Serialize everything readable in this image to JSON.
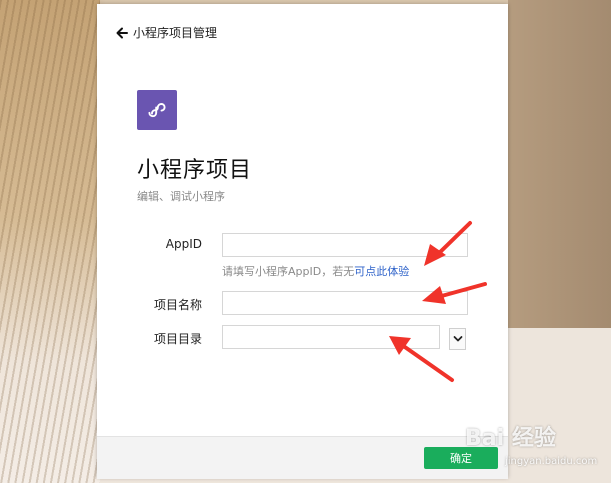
{
  "header": {
    "back_label": "小程序项目管理"
  },
  "app": {
    "title": "小程序项目",
    "subtitle": "编辑、调试小程序",
    "logo_color": "#6a55b1"
  },
  "form": {
    "appid_label": "AppID",
    "appid_value": "",
    "hint_text": "请填写小程序AppID，若无",
    "hint_link": "可点此体验",
    "name_label": "项目名称",
    "name_value": "",
    "dir_label": "项目目录",
    "dir_value": ""
  },
  "footer": {
    "confirm_label": "确定",
    "confirm_color": "#1aad5c"
  },
  "watermark": {
    "brand": "Bai 经验",
    "url": "jingyan.baidu.com"
  },
  "annotation_color": "#f0332a"
}
